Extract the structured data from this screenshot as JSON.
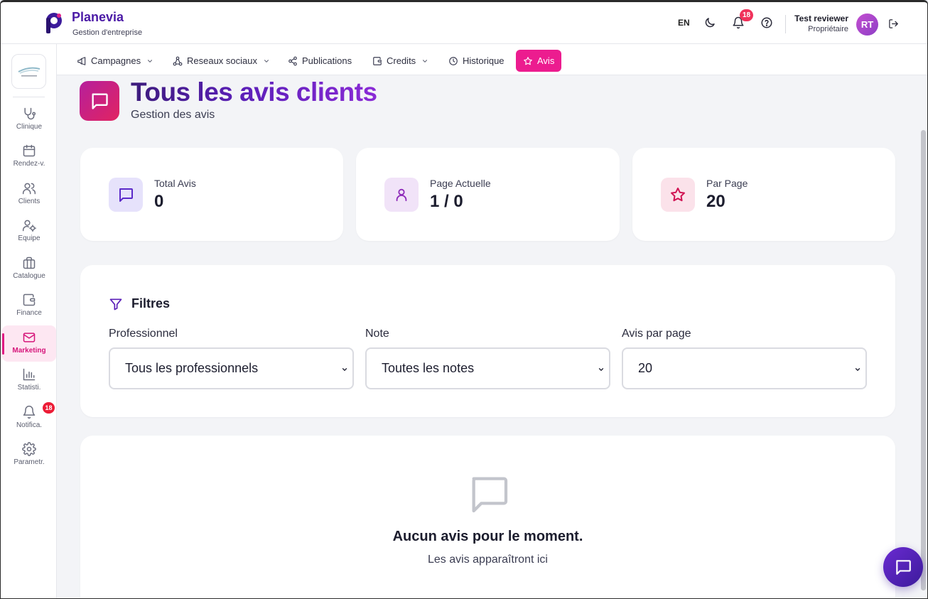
{
  "brand": {
    "name": "Planevia",
    "subtitle": "Gestion d'entreprise"
  },
  "header": {
    "language": "EN",
    "notification_count": "18",
    "user_name": "Test reviewer",
    "user_role": "Propriétaire",
    "avatar_initials": "RT"
  },
  "sidebar": {
    "items": [
      {
        "label": "Clinique",
        "icon": "stethoscope-icon"
      },
      {
        "label": "Rendez-v.",
        "icon": "calendar-icon"
      },
      {
        "label": "Clients",
        "icon": "users-icon"
      },
      {
        "label": "Equipe",
        "icon": "user-gear-icon"
      },
      {
        "label": "Catalogue",
        "icon": "briefcase-icon"
      },
      {
        "label": "Finance",
        "icon": "wallet-icon"
      },
      {
        "label": "Marketing",
        "icon": "mail-icon",
        "active": true
      },
      {
        "label": "Statisti.",
        "icon": "bar-chart-icon"
      },
      {
        "label": "Notifica.",
        "icon": "bell-icon",
        "badge": "18"
      },
      {
        "label": "Parametr.",
        "icon": "gear-icon"
      }
    ]
  },
  "subnav": {
    "tabs": [
      {
        "label": "Campagnes",
        "icon": "megaphone-icon"
      },
      {
        "label": "Reseaux sociaux",
        "icon": "network-icon"
      },
      {
        "label": "Publications",
        "icon": "share-icon"
      },
      {
        "label": "Credits",
        "icon": "wallet-icon"
      },
      {
        "label": "Historique",
        "icon": "clock-icon"
      },
      {
        "label": "Avis",
        "icon": "star-icon",
        "active": true
      }
    ]
  },
  "page": {
    "title": "Tous les avis clients",
    "subtitle": "Gestion des avis"
  },
  "stats": [
    {
      "label": "Total Avis",
      "value": "0",
      "icon": "message-icon"
    },
    {
      "label": "Page Actuelle",
      "value": "1 / 0",
      "icon": "user-icon"
    },
    {
      "label": "Par Page",
      "value": "20",
      "icon": "star-icon"
    }
  ],
  "filters": {
    "title": "Filtres",
    "professionnel": {
      "label": "Professionnel",
      "value": "Tous les professionnels"
    },
    "note": {
      "label": "Note",
      "value": "Toutes les notes"
    },
    "per_page": {
      "label": "Avis par page",
      "value": "20"
    }
  },
  "empty_state": {
    "title": "Aucun avis pour le moment.",
    "subtitle": "Les avis apparaîtront ici"
  },
  "colors": {
    "brand": "#4b1aa6",
    "accent_pink": "#ec1c8f",
    "badge_red": "#ec1c36",
    "fab": "#5a24c0"
  }
}
